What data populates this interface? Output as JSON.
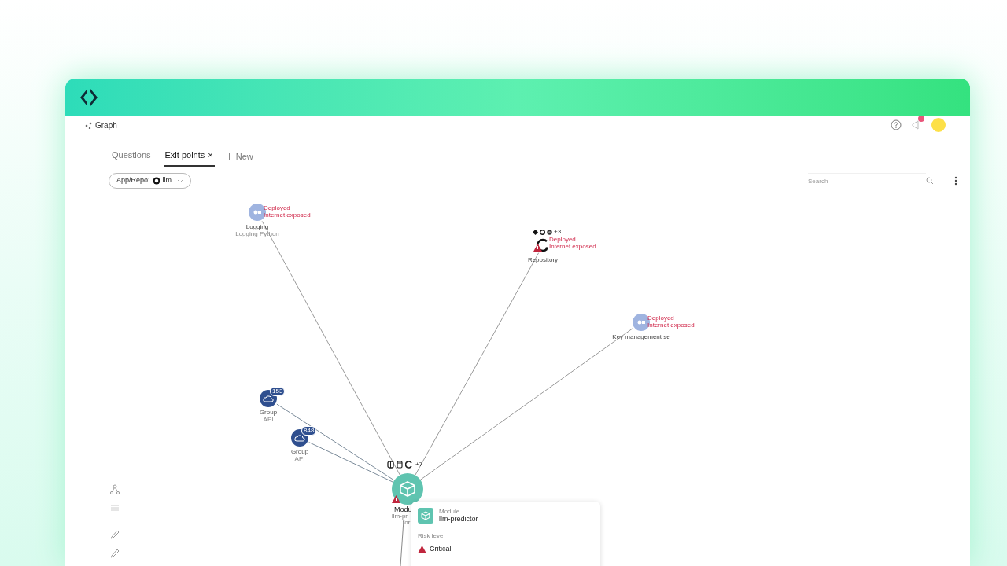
{
  "breadcrumb": "Graph",
  "notifications": {
    "unread": true
  },
  "tabs": [
    {
      "label": "Questions",
      "selected": false
    },
    {
      "label": "Exit points",
      "selected": true,
      "close": "×"
    }
  ],
  "new_tab": "New",
  "filter": {
    "label": "App/Repo:",
    "value": "llm"
  },
  "search": {
    "placeholder": "Search"
  },
  "nodes": [
    {
      "kind": "service",
      "label": "Logging",
      "sublabel": "Logging Python",
      "tags": [
        "Deployed",
        "Internet exposed"
      ]
    },
    {
      "kind": "repository",
      "label": "Repository",
      "more": "+3",
      "tags": [
        "Deployed",
        "Internet exposed"
      ],
      "warning": true
    },
    {
      "kind": "service",
      "label": "Key management se",
      "tags": [
        "Deployed",
        "Internet exposed"
      ]
    },
    {
      "kind": "group",
      "label": "Group",
      "sublabel": "API",
      "badge": "153"
    },
    {
      "kind": "group",
      "label": "Group",
      "sublabel": "API",
      "badge": "848"
    },
    {
      "kind": "module",
      "label": "Modu",
      "sublabel": "llm-pr",
      "sublabel2": "for",
      "more": "+7",
      "warning": true
    }
  ],
  "details": {
    "type": "Module",
    "name": "llm-predictor",
    "risk_label": "Risk level",
    "risk": "Critical"
  }
}
